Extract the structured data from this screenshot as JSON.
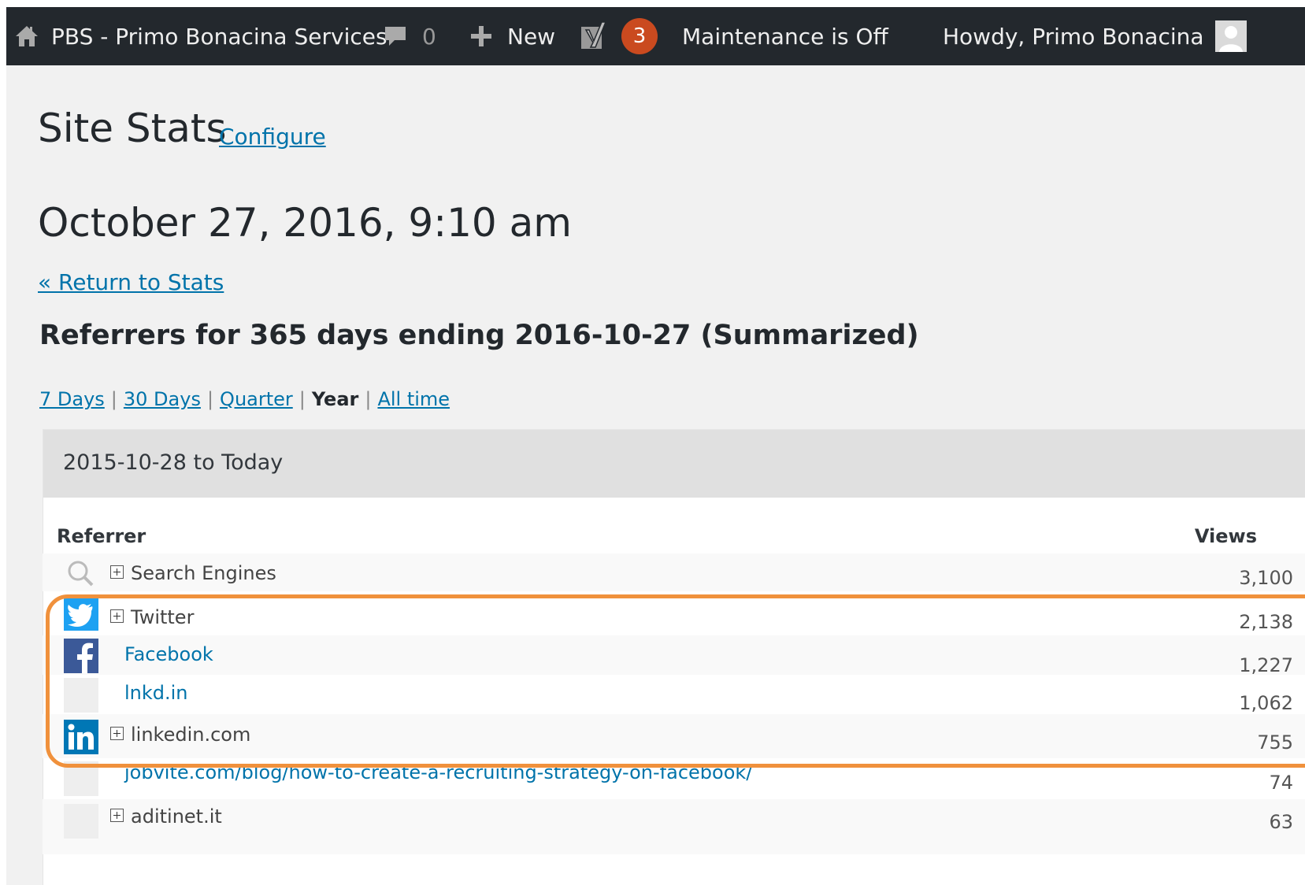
{
  "admin_bar": {
    "site_name": "PBS - Primo Bonacina Services",
    "comments_count": "0",
    "new_label": "New",
    "yoast_count": "3",
    "maintenance_label": "Maintenance is Off",
    "greeting": "Howdy, Primo Bonacina",
    "icons": [
      "home-icon",
      "comment-icon",
      "plus-icon",
      "yoast-icon",
      "avatar"
    ]
  },
  "page": {
    "title": "Site Stats",
    "configure_link": "Configure",
    "date": "October 27, 2016, 9:10 am",
    "return_link": "« Return to Stats",
    "heading": "Referrers for 365 days ending 2016-10-27 (Summarized)"
  },
  "ranges": [
    {
      "label": "7 Days",
      "active": false
    },
    {
      "label": "30 Days",
      "active": false
    },
    {
      "label": "Quarter",
      "active": false
    },
    {
      "label": "Year",
      "active": true
    },
    {
      "label": "All time",
      "active": false
    }
  ],
  "range_separator": "|",
  "panel": {
    "title": "2015-10-28 to Today",
    "col_referrer": "Referrer",
    "col_views": "Views",
    "rows": [
      {
        "name": "Search Engines",
        "views": "3,100",
        "icon": "search-icon",
        "expandable": true,
        "link": false
      },
      {
        "name": "Twitter",
        "views": "2,138",
        "icon": "twitter-icon",
        "expandable": true,
        "link": false
      },
      {
        "name": "Facebook",
        "views": "1,227",
        "icon": "facebook-icon",
        "expandable": false,
        "link": true
      },
      {
        "name": "lnkd.in",
        "views": "1,062",
        "icon": "blank-icon",
        "expandable": false,
        "link": true
      },
      {
        "name": "linkedin.com",
        "views": "755",
        "icon": "linkedin-icon",
        "expandable": true,
        "link": false
      },
      {
        "name": "jobvite.com/blog/how-to-create-a-recruiting-strategy-on-facebook/",
        "views": "74",
        "icon": "blank-icon",
        "expandable": false,
        "link": true
      },
      {
        "name": "aditinet.it",
        "views": "63",
        "icon": "blank-icon",
        "expandable": true,
        "link": false
      }
    ]
  },
  "colors": {
    "admin_bar_bg": "#23282d",
    "link": "#0073aa",
    "badge": "#ca4a1f",
    "highlight": "#f0913c",
    "twitter": "#1da1f2",
    "facebook": "#3b5998",
    "linkedin": "#0077b5"
  }
}
